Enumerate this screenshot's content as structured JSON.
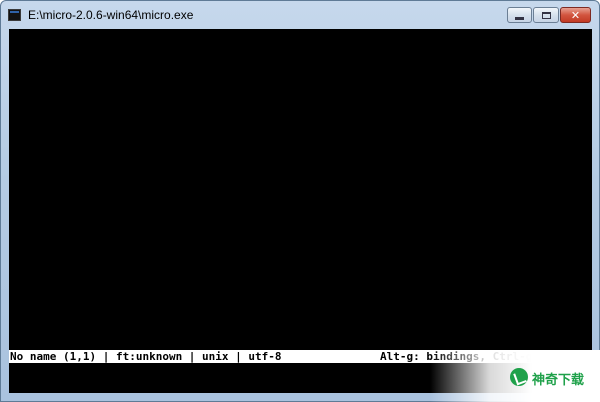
{
  "window": {
    "title": "E:\\micro-2.0.6-win64\\micro.exe"
  },
  "controls": {
    "minimize": "minimize-icon",
    "maximize": "maximize-icon",
    "close_glyph": "✕"
  },
  "statusbar": {
    "left": "No name (1,1) | ft:unknown | unix | utf-8",
    "right": "Alt-g: bindings, Ctrl-g: help"
  },
  "watermark": {
    "text": "神奇下载"
  }
}
